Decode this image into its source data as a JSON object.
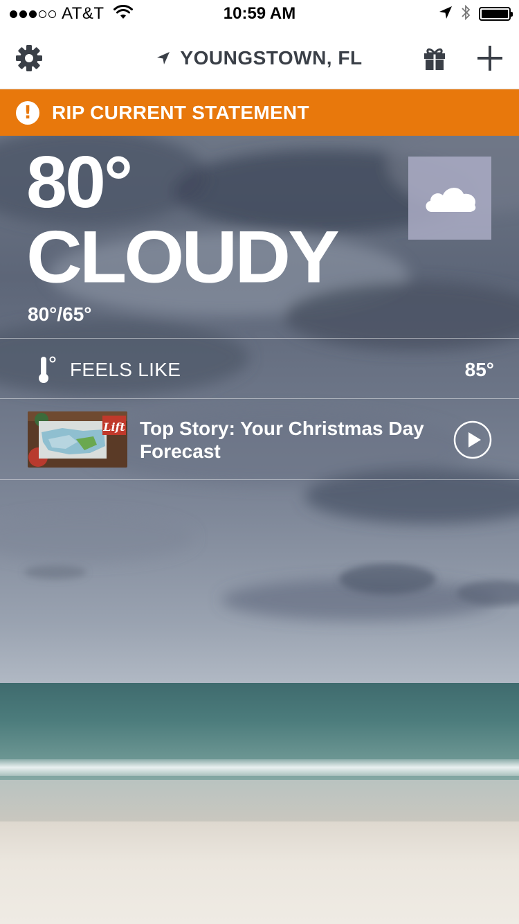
{
  "status_bar": {
    "carrier": "AT&T",
    "signal_bars": 3,
    "signal_total": 5,
    "time": "10:59 AM",
    "battery_level": 1.0
  },
  "nav": {
    "location": "YOUNGSTOWN, FL",
    "icons": [
      "gear-icon",
      "location-arrow-icon",
      "gift-icon",
      "plus-icon"
    ]
  },
  "alert": {
    "text": "RIP CURRENT STATEMENT",
    "color": "#e8780c"
  },
  "weather": {
    "temperature": "80°",
    "condition": "CLOUDY",
    "hi_lo": "80°/65°",
    "condition_icon": "cloud-icon"
  },
  "feels_like": {
    "label": "FEELS LIKE",
    "value": "85°"
  },
  "story": {
    "title": "Top Story: Your Christmas Day Forecast",
    "thumbnail_caption": "Lift"
  }
}
